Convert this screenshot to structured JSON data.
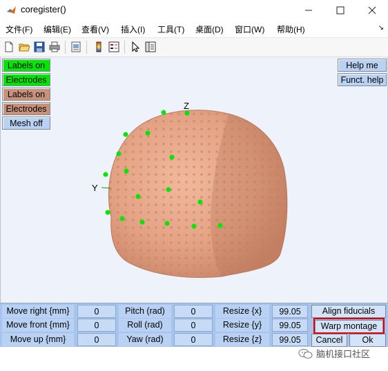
{
  "window": {
    "title": "coregister()",
    "minimize_icon": "minimize-icon",
    "maximize_icon": "maximize-icon",
    "close_icon": "close-icon"
  },
  "menu": {
    "items": [
      "文件(F)",
      "编辑(E)",
      "查看(V)",
      "插入(I)",
      "工具(T)",
      "桌面(D)",
      "窗口(W)",
      "帮助(H)"
    ],
    "overflow_icon": "chevron-icon"
  },
  "toolbar": {
    "icons": [
      "new-figure-icon",
      "open-file-icon",
      "save-icon",
      "print-icon",
      "print-preview-icon",
      "colorbar-icon",
      "legend-icon",
      "pointer-icon",
      "property-editor-icon"
    ]
  },
  "left_buttons": [
    {
      "label": "Labels on",
      "style": "green"
    },
    {
      "label": "Electrodes",
      "style": "green"
    },
    {
      "label": "Labels on",
      "style": "tan"
    },
    {
      "label": "Electrodes",
      "style": "tan"
    },
    {
      "label": "Mesh off",
      "style": "lblue"
    }
  ],
  "right_buttons": [
    "Help me",
    "Funct. help"
  ],
  "axes": {
    "z": "Z",
    "y": "Y"
  },
  "colors": {
    "head": "#e8a98c",
    "electrode": "#00e600",
    "background": "#eef3fb",
    "panel": "#a9c4ec",
    "highlight": "#e30000"
  },
  "panel": {
    "rows": [
      {
        "label": "Move right {mm}",
        "value": "0",
        "rot_label": "Pitch (rad)",
        "rot_value": "0",
        "resize_label": "Resize {x}",
        "resize_value": "99.05"
      },
      {
        "label": "Move front {mm}",
        "value": "0",
        "rot_label": "Roll (rad)",
        "rot_value": "0",
        "resize_label": "Resize {y}",
        "resize_value": "99.05"
      },
      {
        "label": "Move up {mm}",
        "value": "0",
        "rot_label": "Yaw (rad)",
        "rot_value": "0",
        "resize_label": "Resize {z}",
        "resize_value": "99.05"
      }
    ],
    "align_button": "Align fiducials",
    "warp_button": "Warp montage",
    "cancel_button": "Cancel",
    "ok_button": "Ok"
  },
  "watermark": "脑机接口社区"
}
